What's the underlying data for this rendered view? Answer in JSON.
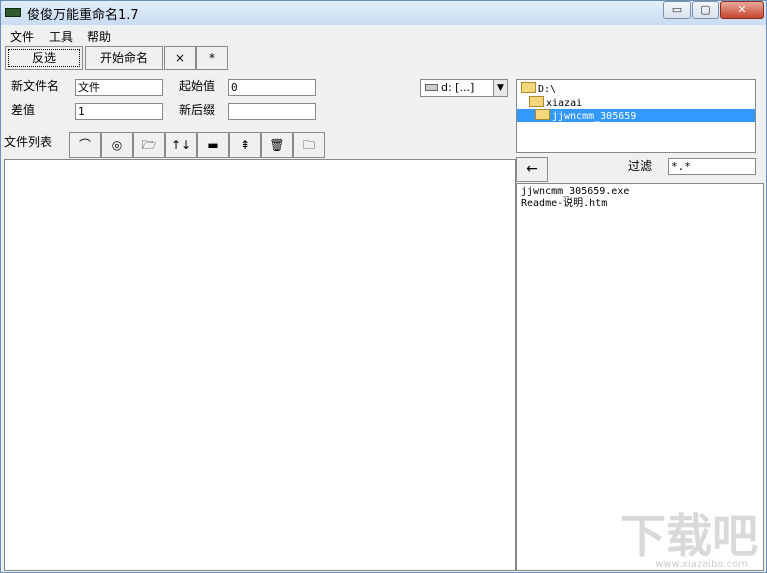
{
  "window": {
    "title": "俊俊万能重命名1.7",
    "controls": {
      "minimize": "▭",
      "maximize": "▢",
      "close": "✕"
    }
  },
  "menu": [
    "文件",
    "工具",
    "帮助"
  ],
  "toolbar": {
    "invert_label": "反选",
    "start_label": "开始命名",
    "clear_label": "×",
    "all_label": "*"
  },
  "form": {
    "new_name_label": "新文件名",
    "new_name_value": "文件",
    "diff_label": "差值",
    "diff_value": "1",
    "start_label": "起始值",
    "start_value": "0",
    "new_ext_label": "新后缀",
    "new_ext_value": ""
  },
  "drive": {
    "value": "d: [...]"
  },
  "file_list": {
    "label": "文件列表",
    "tools": [
      {
        "name": "undo-icon",
        "glyph": "⌒"
      },
      {
        "name": "target-icon",
        "glyph": "◎"
      },
      {
        "name": "open-folder-icon",
        "glyph": "🗁"
      },
      {
        "name": "sort-icon",
        "glyph": "↑↓"
      },
      {
        "name": "remove-icon",
        "glyph": "▬"
      },
      {
        "name": "move-icon",
        "glyph": "⇞"
      },
      {
        "name": "delete-icon",
        "glyph": "🗑"
      },
      {
        "name": "folder-icon",
        "glyph": "🗀"
      }
    ]
  },
  "tree": {
    "items": [
      "D:\\",
      "xiazai",
      "jjwncmm_305659"
    ],
    "selected": 2
  },
  "filter": {
    "back_label": "←",
    "label": "过滤",
    "value": "*.*"
  },
  "files": [
    "jjwncmm_305659.exe",
    "Readme-说明.htm"
  ],
  "watermark": {
    "text": "下载吧",
    "url": "www.xiazaiba.com"
  },
  "colors": {
    "selection": "#3399ff",
    "title_gradient_top": "#e3edf9"
  }
}
